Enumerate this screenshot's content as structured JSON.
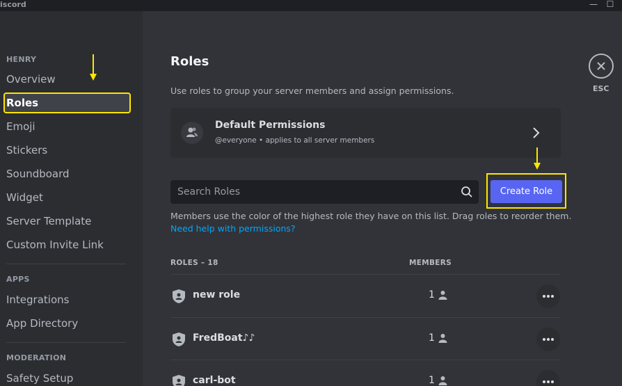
{
  "titlebar": {
    "app_name": "iscord",
    "minimize_glyph": "—",
    "maximize_glyph": "☐"
  },
  "sidebar": {
    "sections": [
      {
        "header": "HENRY",
        "items": [
          {
            "label": "Overview",
            "selected": false
          },
          {
            "label": "Roles",
            "selected": true
          },
          {
            "label": "Emoji",
            "selected": false
          },
          {
            "label": "Stickers",
            "selected": false
          },
          {
            "label": "Soundboard",
            "selected": false
          },
          {
            "label": "Widget",
            "selected": false
          },
          {
            "label": "Server Template",
            "selected": false
          },
          {
            "label": "Custom Invite Link",
            "selected": false
          }
        ]
      },
      {
        "header": "APPS",
        "items": [
          {
            "label": "Integrations",
            "selected": false
          },
          {
            "label": "App Directory",
            "selected": false
          }
        ]
      },
      {
        "header": "MODERATION",
        "items": [
          {
            "label": "Safety Setup",
            "selected": false
          }
        ]
      }
    ]
  },
  "main": {
    "title": "Roles",
    "description": "Use roles to group your server members and assign permissions.",
    "default_permissions": {
      "title": "Default Permissions",
      "subtitle": "@everyone • applies to all server members",
      "icon": "people-icon"
    },
    "search": {
      "placeholder": "Search Roles",
      "value": ""
    },
    "create_role_label": "Create Role",
    "help_text": "Members use the color of the highest role they have on this list. Drag roles to reorder them.",
    "help_link": "Need help with permissions?",
    "table": {
      "roles_header": "ROLES – 18",
      "members_header": "MEMBERS",
      "rows": [
        {
          "name": "new role",
          "members": "1"
        },
        {
          "name": "FredBoat♪♪",
          "members": "1"
        },
        {
          "name": "carl-bot",
          "members": "1"
        }
      ]
    }
  },
  "close": {
    "label": "ESC"
  },
  "colors": {
    "accent": "#5865f2",
    "annotation": "#ffe600",
    "link": "#00a8fc"
  }
}
